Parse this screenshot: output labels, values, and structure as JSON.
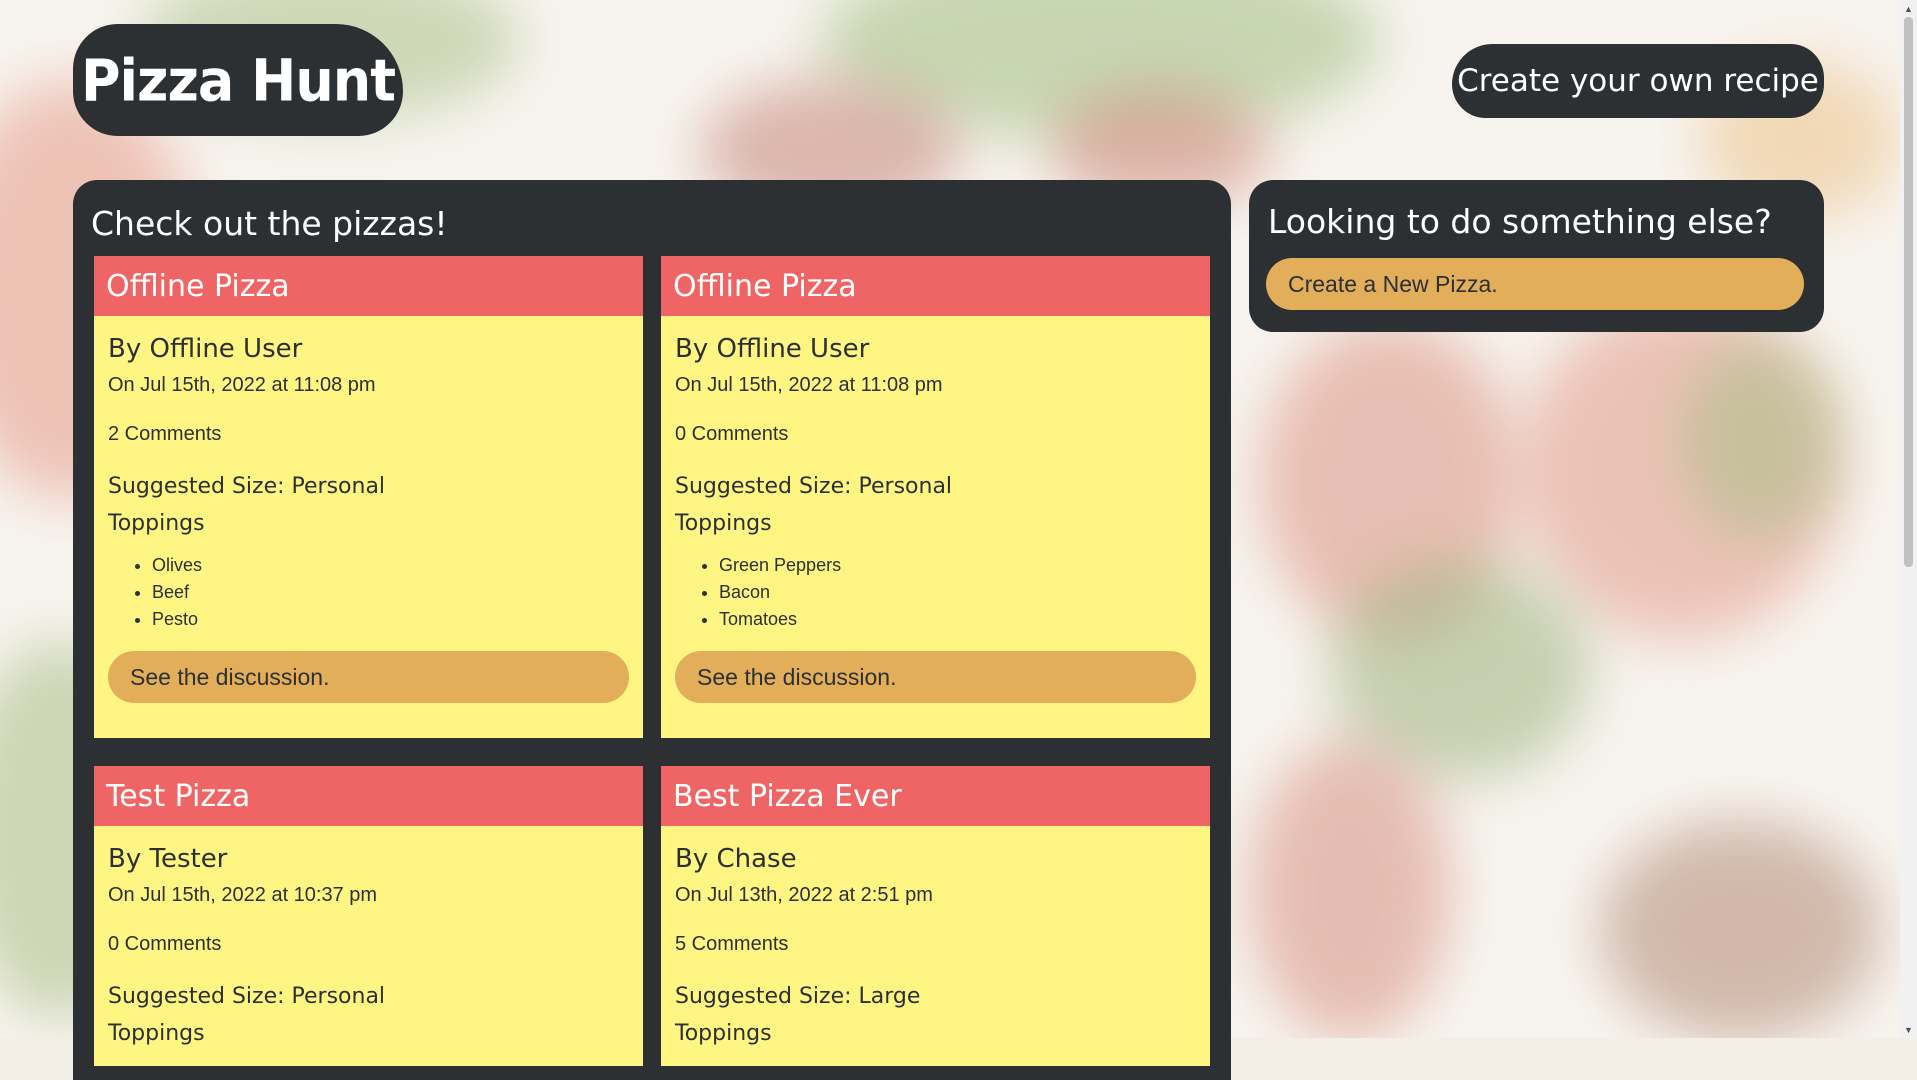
{
  "header": {
    "logo_text": "Pizza Hunt",
    "create_recipe_label": "Create your own recipe"
  },
  "main": {
    "title": "Check out the pizzas!",
    "pizzas": [
      {
        "name": "Offline Pizza",
        "author": "By Offline User",
        "date": "On Jul 15th, 2022 at 11:08 pm",
        "comments": "2 Comments",
        "size": "Suggested Size: Personal",
        "toppings_label": "Toppings",
        "toppings": [
          "Olives",
          "Beef",
          "Pesto"
        ],
        "discussion_label": "See the discussion."
      },
      {
        "name": "Offline Pizza",
        "author": "By Offline User",
        "date": "On Jul 15th, 2022 at 11:08 pm",
        "comments": "0 Comments",
        "size": "Suggested Size: Personal",
        "toppings_label": "Toppings",
        "toppings": [
          "Green Peppers",
          "Bacon",
          "Tomatoes"
        ],
        "discussion_label": "See the discussion."
      },
      {
        "name": "Test Pizza",
        "author": "By Tester",
        "date": "On Jul 15th, 2022 at 10:37 pm",
        "comments": "0 Comments",
        "size": "Suggested Size: Personal",
        "toppings_label": "Toppings"
      },
      {
        "name": "Best Pizza Ever",
        "author": "By Chase",
        "date": "On Jul 13th, 2022 at 2:51 pm",
        "comments": "5 Comments",
        "size": "Suggested Size: Large",
        "toppings_label": "Toppings"
      }
    ]
  },
  "sidebar": {
    "title": "Looking to do something else?",
    "new_pizza_label": "Create a New Pizza."
  },
  "colors": {
    "panel": "#2c3033",
    "card_header": "#ef6565",
    "card_body": "#fef582",
    "button": "#e3ae5a"
  },
  "icons": {
    "scroll_up": "chevron-up-icon",
    "scroll_down": "chevron-down-icon"
  }
}
